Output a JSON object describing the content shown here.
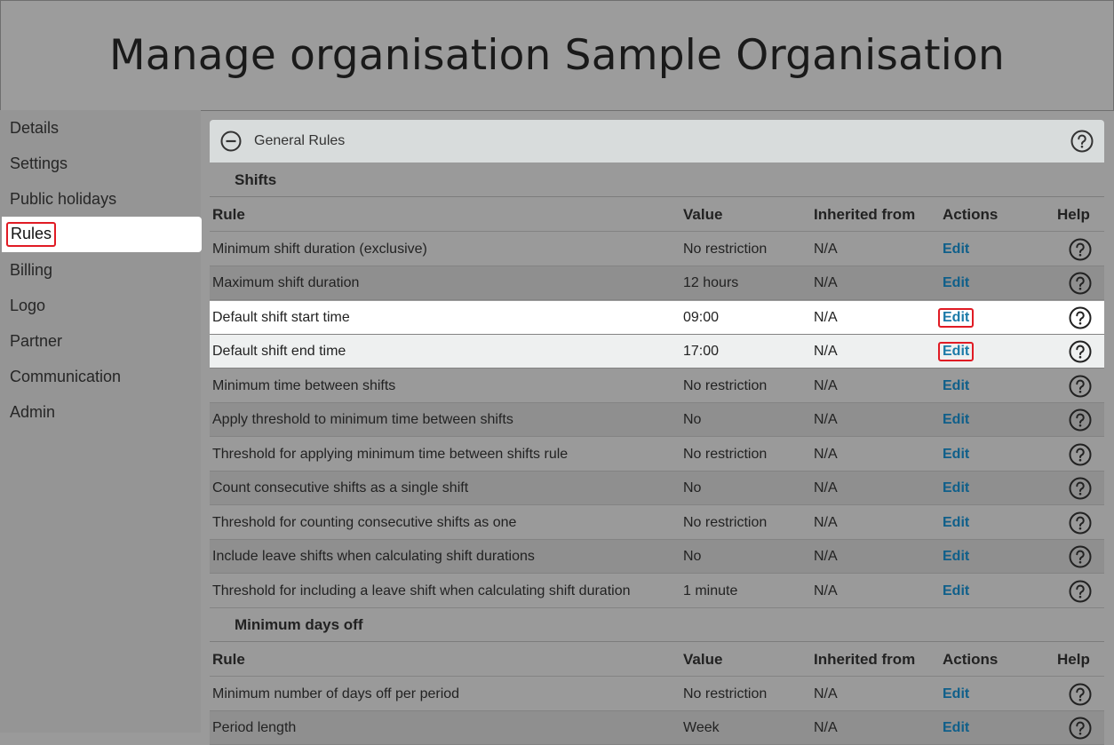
{
  "header": {
    "title": "Manage organisation Sample Organisation"
  },
  "sidebar": {
    "items": [
      {
        "label": "Details"
      },
      {
        "label": "Settings"
      },
      {
        "label": "Public holidays"
      },
      {
        "label": "Rules",
        "active": true
      },
      {
        "label": "Billing"
      },
      {
        "label": "Logo"
      },
      {
        "label": "Partner"
      },
      {
        "label": "Communication"
      },
      {
        "label": "Admin"
      }
    ]
  },
  "panel": {
    "title": "General Rules",
    "collapse_icon": "minus-circle-icon",
    "help_icon": "question-circle-icon"
  },
  "columns": {
    "rule": "Rule",
    "value": "Value",
    "inherited": "Inherited from",
    "actions": "Actions",
    "help": "Help"
  },
  "sections": [
    {
      "title": "Shifts",
      "rows": [
        {
          "rule": "Minimum shift duration (exclusive)",
          "value": "No restriction",
          "inherited": "N/A",
          "action": "Edit"
        },
        {
          "rule": "Maximum shift duration",
          "value": "12 hours",
          "inherited": "N/A",
          "action": "Edit"
        },
        {
          "rule": "Default shift start time",
          "value": "09:00",
          "inherited": "N/A",
          "action": "Edit",
          "highlighted": true
        },
        {
          "rule": "Default shift end time",
          "value": "17:00",
          "inherited": "N/A",
          "action": "Edit",
          "highlighted": true
        },
        {
          "rule": "Minimum time between shifts",
          "value": "No restriction",
          "inherited": "N/A",
          "action": "Edit"
        },
        {
          "rule": "Apply threshold to minimum time between shifts",
          "value": "No",
          "inherited": "N/A",
          "action": "Edit"
        },
        {
          "rule": "Threshold for applying minimum time between shifts rule",
          "value": "No restriction",
          "inherited": "N/A",
          "action": "Edit"
        },
        {
          "rule": "Count consecutive shifts as a single shift",
          "value": "No",
          "inherited": "N/A",
          "action": "Edit"
        },
        {
          "rule": "Threshold for counting consecutive shifts as one",
          "value": "No restriction",
          "inherited": "N/A",
          "action": "Edit"
        },
        {
          "rule": "Include leave shifts when calculating shift durations",
          "value": "No",
          "inherited": "N/A",
          "action": "Edit"
        },
        {
          "rule": "Threshold for including a leave shift when calculating shift duration",
          "value": "1 minute",
          "inherited": "N/A",
          "action": "Edit"
        }
      ]
    },
    {
      "title": "Minimum days off",
      "rows": [
        {
          "rule": "Minimum number of days off per period",
          "value": "No restriction",
          "inherited": "N/A",
          "action": "Edit"
        },
        {
          "rule": "Period length",
          "value": "Week",
          "inherited": "N/A",
          "action": "Edit"
        }
      ]
    }
  ],
  "colors": {
    "highlight_border": "#e01b24",
    "link": "#0f5f8a",
    "overlay_gray": "#9a9a9a"
  }
}
